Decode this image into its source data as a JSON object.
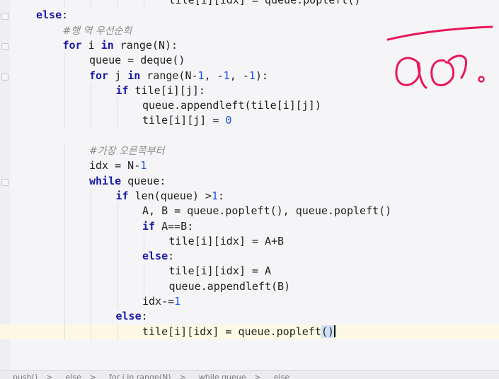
{
  "editor": {
    "lines": [
      {
        "indent": 5,
        "tokens": [
          {
            "t": "tile[i][idx] = queue.popleft()",
            "c": "txt"
          }
        ]
      },
      {
        "indent": 0,
        "tokens": [
          {
            "t": "else",
            "c": "kw"
          },
          {
            "t": ":",
            "c": "txt"
          }
        ]
      },
      {
        "indent": 1,
        "tokens": [
          {
            "t": "#행 역 우선순회",
            "c": "cm"
          }
        ]
      },
      {
        "indent": 1,
        "tokens": [
          {
            "t": "for",
            "c": "kw"
          },
          {
            "t": " i ",
            "c": "txt"
          },
          {
            "t": "in",
            "c": "kw"
          },
          {
            "t": " range(N):",
            "c": "txt"
          }
        ]
      },
      {
        "indent": 2,
        "tokens": [
          {
            "t": "queue = deque()",
            "c": "txt"
          }
        ]
      },
      {
        "indent": 2,
        "tokens": [
          {
            "t": "for",
            "c": "kw"
          },
          {
            "t": " j ",
            "c": "txt"
          },
          {
            "t": "in",
            "c": "kw"
          },
          {
            "t": " range(N-",
            "c": "txt"
          },
          {
            "t": "1",
            "c": "num"
          },
          {
            "t": ", -",
            "c": "txt"
          },
          {
            "t": "1",
            "c": "num"
          },
          {
            "t": ", -",
            "c": "txt"
          },
          {
            "t": "1",
            "c": "num"
          },
          {
            "t": "):",
            "c": "txt"
          }
        ]
      },
      {
        "indent": 3,
        "tokens": [
          {
            "t": "if",
            "c": "kw"
          },
          {
            "t": " tile[i][j]:",
            "c": "txt"
          }
        ]
      },
      {
        "indent": 4,
        "tokens": [
          {
            "t": "queue.appendleft(tile[i][j])",
            "c": "txt"
          }
        ]
      },
      {
        "indent": 4,
        "tokens": [
          {
            "t": "tile[i][j] = ",
            "c": "txt"
          },
          {
            "t": "0",
            "c": "num"
          }
        ]
      },
      {
        "indent": 0,
        "tokens": []
      },
      {
        "indent": 2,
        "tokens": [
          {
            "t": "#가장 오른쪽부터",
            "c": "cm"
          }
        ]
      },
      {
        "indent": 2,
        "tokens": [
          {
            "t": "idx = N-",
            "c": "txt"
          },
          {
            "t": "1",
            "c": "num"
          }
        ]
      },
      {
        "indent": 2,
        "tokens": [
          {
            "t": "while",
            "c": "kw"
          },
          {
            "t": " queue:",
            "c": "txt"
          }
        ]
      },
      {
        "indent": 3,
        "tokens": [
          {
            "t": "if",
            "c": "kw"
          },
          {
            "t": " len(queue) >",
            "c": "txt"
          },
          {
            "t": "1",
            "c": "num"
          },
          {
            "t": ":",
            "c": "txt"
          }
        ]
      },
      {
        "indent": 4,
        "tokens": [
          {
            "t": "A, B = queue.popleft(), queue.popleft()",
            "c": "txt"
          }
        ]
      },
      {
        "indent": 4,
        "tokens": [
          {
            "t": "if",
            "c": "kw"
          },
          {
            "t": " A==B:",
            "c": "txt"
          }
        ]
      },
      {
        "indent": 5,
        "tokens": [
          {
            "t": "tile[i][idx] = A+B",
            "c": "txt"
          }
        ]
      },
      {
        "indent": 4,
        "tokens": [
          {
            "t": "else",
            "c": "kw"
          },
          {
            "t": ":",
            "c": "txt"
          }
        ]
      },
      {
        "indent": 5,
        "tokens": [
          {
            "t": "tile[i][idx] = A",
            "c": "txt"
          }
        ]
      },
      {
        "indent": 5,
        "tokens": [
          {
            "t": "queue.appendleft(B)",
            "c": "txt"
          }
        ]
      },
      {
        "indent": 4,
        "tokens": [
          {
            "t": "idx-=",
            "c": "txt"
          },
          {
            "t": "1",
            "c": "num"
          }
        ]
      },
      {
        "indent": 3,
        "tokens": [
          {
            "t": "else",
            "c": "kw"
          },
          {
            "t": ":",
            "c": "txt"
          }
        ]
      },
      {
        "indent": 4,
        "current": true,
        "tokens": [
          {
            "t": "tile[i][idx] = queue.popleft",
            "c": "txt"
          },
          {
            "t": "()",
            "c": "paren"
          }
        ]
      }
    ]
  },
  "breadcrumb": {
    "items": [
      "push()",
      "else",
      "for i in range(N)",
      "while queue",
      "else"
    ],
    "separator": ">"
  },
  "colors": {
    "keyword": "#1a1aa6",
    "number": "#1750eb",
    "comment": "#8c8c8c",
    "current_line": "#fbf8e4",
    "annotation": "#e8185a"
  }
}
